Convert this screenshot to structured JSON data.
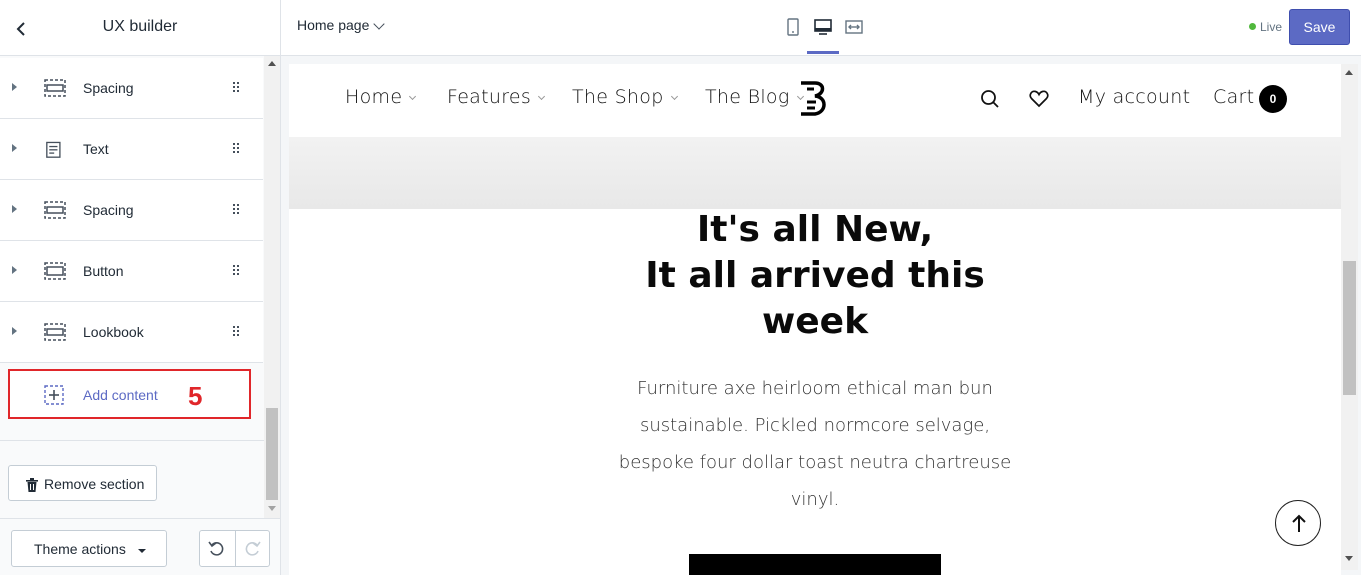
{
  "sidebar": {
    "title": "UX builder",
    "items": [
      {
        "label": "Spacing",
        "icon": "spacing-icon"
      },
      {
        "label": "Text",
        "icon": "text-icon"
      },
      {
        "label": "Spacing",
        "icon": "spacing-icon"
      },
      {
        "label": "Button",
        "icon": "button-icon"
      },
      {
        "label": "Lookbook",
        "icon": "lookbook-icon"
      }
    ],
    "add_content": {
      "label": "Add content",
      "annotation": "5",
      "icon": "add-block-icon"
    },
    "remove_section_label": "Remove section",
    "theme_actions_label": "Theme actions"
  },
  "topbar": {
    "page_label": "Home page",
    "devices": [
      "mobile-icon",
      "desktop-icon",
      "fullwidth-icon"
    ],
    "active_device": "desktop-icon",
    "live_label": "Live",
    "save_label": "Save"
  },
  "preview": {
    "nav": [
      {
        "label": "Home"
      },
      {
        "label": "Features"
      },
      {
        "label": "The Shop"
      },
      {
        "label": "The Blog"
      }
    ],
    "account_label": "My account",
    "cart_label": "Cart",
    "cart_count": "0",
    "hero_title_lines": [
      "It's all New,",
      "It all arrived this",
      "week"
    ],
    "hero_text": "Furniture axe heirloom ethical man bun sustainable. Pickled normcore selvage, bespoke four dollar toast neutra chartreuse vinyl."
  },
  "colors": {
    "accent": "#5c6ac4",
    "highlight": "#e0262a",
    "live": "#50b83c"
  }
}
